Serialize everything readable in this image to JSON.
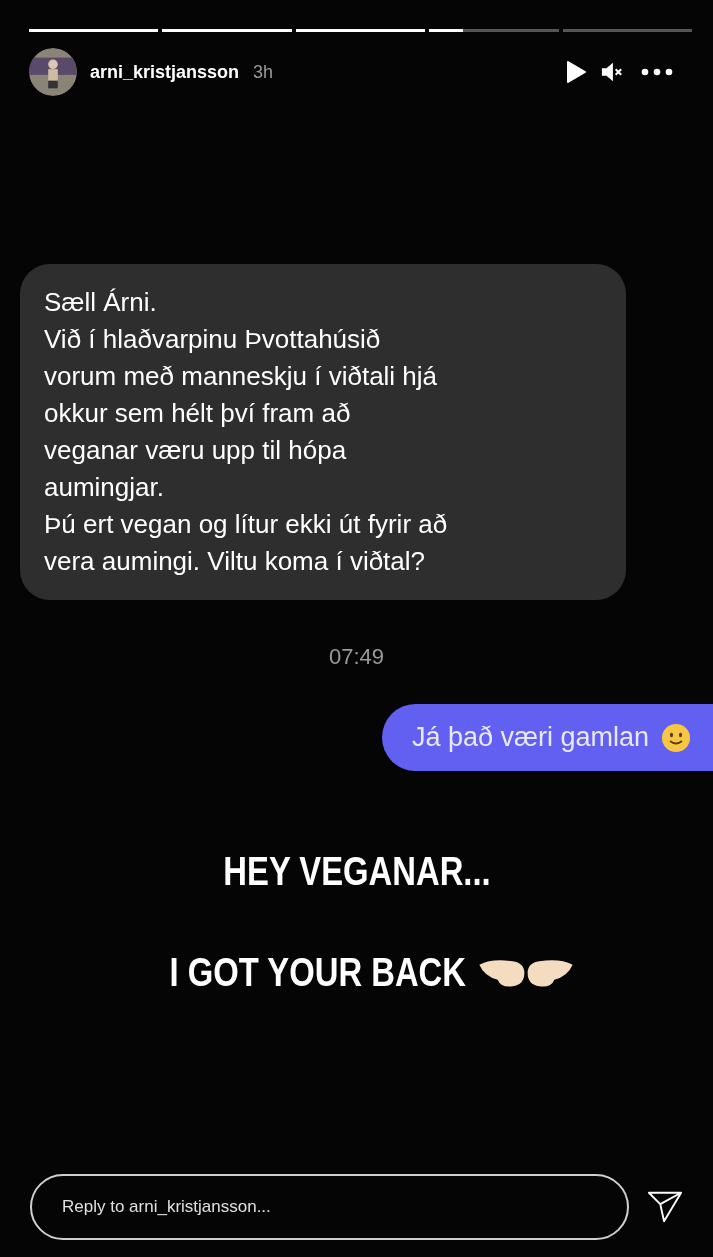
{
  "progress": [
    {
      "level": 1
    },
    {
      "level": 1
    },
    {
      "level": 1
    },
    {
      "level": 0.26
    },
    {
      "level": 0
    }
  ],
  "header": {
    "username": "arni_kristjansson",
    "time": "3h",
    "paused": true,
    "muted": true
  },
  "messages": [
    {
      "kind": "received",
      "lines": [
        "Sæll Árni.",
        "Við í hlaðvarpinu Þvottahúsið",
        "vorum með manneskju í viðtali hjá",
        "okkur sem hélt því fram að",
        "veganar væru upp til hópa",
        "aumingjar.",
        "Þú ert vegan og lítur ekki út fyrir að",
        "vera aumingi. Viltu koma í viðtal?"
      ]
    },
    {
      "kind": "timestamp",
      "text": "07:49"
    },
    {
      "kind": "sent",
      "text": "Já það væri gamlan"
    }
  ],
  "captions": [
    "HEY VEGANAR...",
    "I GOT YOUR BACK"
  ],
  "reply": {
    "placeholder": "Reply to arni_kristjansson..."
  }
}
